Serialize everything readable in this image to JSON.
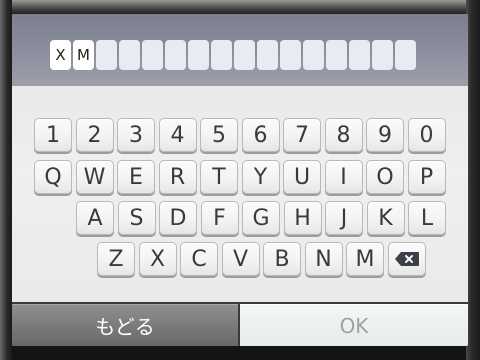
{
  "input": {
    "entered": [
      "X",
      "M"
    ],
    "total_slots": 16
  },
  "keyboard": {
    "rows": [
      [
        "1",
        "2",
        "3",
        "4",
        "5",
        "6",
        "7",
        "8",
        "9",
        "0"
      ],
      [
        "Q",
        "W",
        "E",
        "R",
        "T",
        "Y",
        "U",
        "I",
        "O",
        "P"
      ],
      [
        "A",
        "S",
        "D",
        "F",
        "G",
        "H",
        "J",
        "K",
        "L"
      ],
      [
        "Z",
        "X",
        "C",
        "V",
        "B",
        "N",
        "M"
      ]
    ],
    "backspace_icon": "backspace-icon"
  },
  "buttons": {
    "back_label": "もどる",
    "ok_label": "OK"
  },
  "colors": {
    "ok_text": "#9aa3a0",
    "back_bg": "#7b7b7b"
  }
}
